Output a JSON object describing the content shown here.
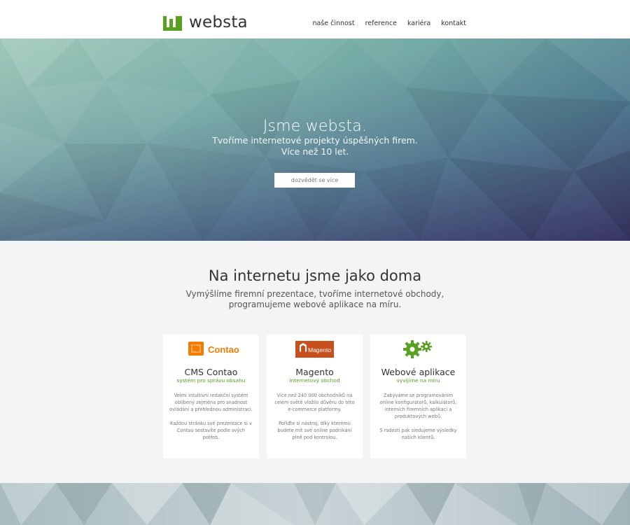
{
  "header": {
    "logo_text": "websta",
    "logo_color": "#5aa122",
    "nav": [
      "naše činnost",
      "reference",
      "kariéra",
      "kontakt"
    ]
  },
  "hero": {
    "title": "Jsme websta.",
    "subtitle": "Tvoříme internetové projekty úspěšných firem. Více než 10 let.",
    "button_label": "dozvědět se více"
  },
  "intro": {
    "title": "Na internetu jsme jako doma",
    "subtitle": "Vymýšlíme firemní prezentace, tvoříme internetové obchody, programujeme webové aplikace na míru."
  },
  "cards": [
    {
      "icon": "contao-logo",
      "logo_text": "Contao",
      "title": "CMS Contao",
      "subtitle": "systém pro správu obsahu",
      "paragraphs": [
        "Velmi intuitivní redakční systém oblíbený zejména pro snadnost ovládání a přehlednou administraci.",
        "Každou stránku své prezentace si v Contau sestavíte podle svých potřeb."
      ]
    },
    {
      "icon": "magento-logo",
      "logo_text": "Magento",
      "title": "Magento",
      "subtitle": "Internetový obchod",
      "paragraphs": [
        "Více než 240 000 obchodníků na celém světě vložilo důvěru do této e-commerce platformy.",
        "Pořiďte si nástroj, díky kterému budete mít své online podnikání plně pod kontrolou."
      ]
    },
    {
      "icon": "gears-icon",
      "title": "Webové aplikace",
      "subtitle": "vyvíjíme na míru",
      "paragraphs": [
        "Zabýváme se programováním online konfigurátorů, kalkulátorů, interních firemních aplikací a produktových webů.",
        "S radostí pak sledujeme výsledky našich klientů."
      ]
    }
  ],
  "colors": {
    "accent": "#5aa122",
    "contao": "#f47c00",
    "magento": "#c8501e"
  }
}
